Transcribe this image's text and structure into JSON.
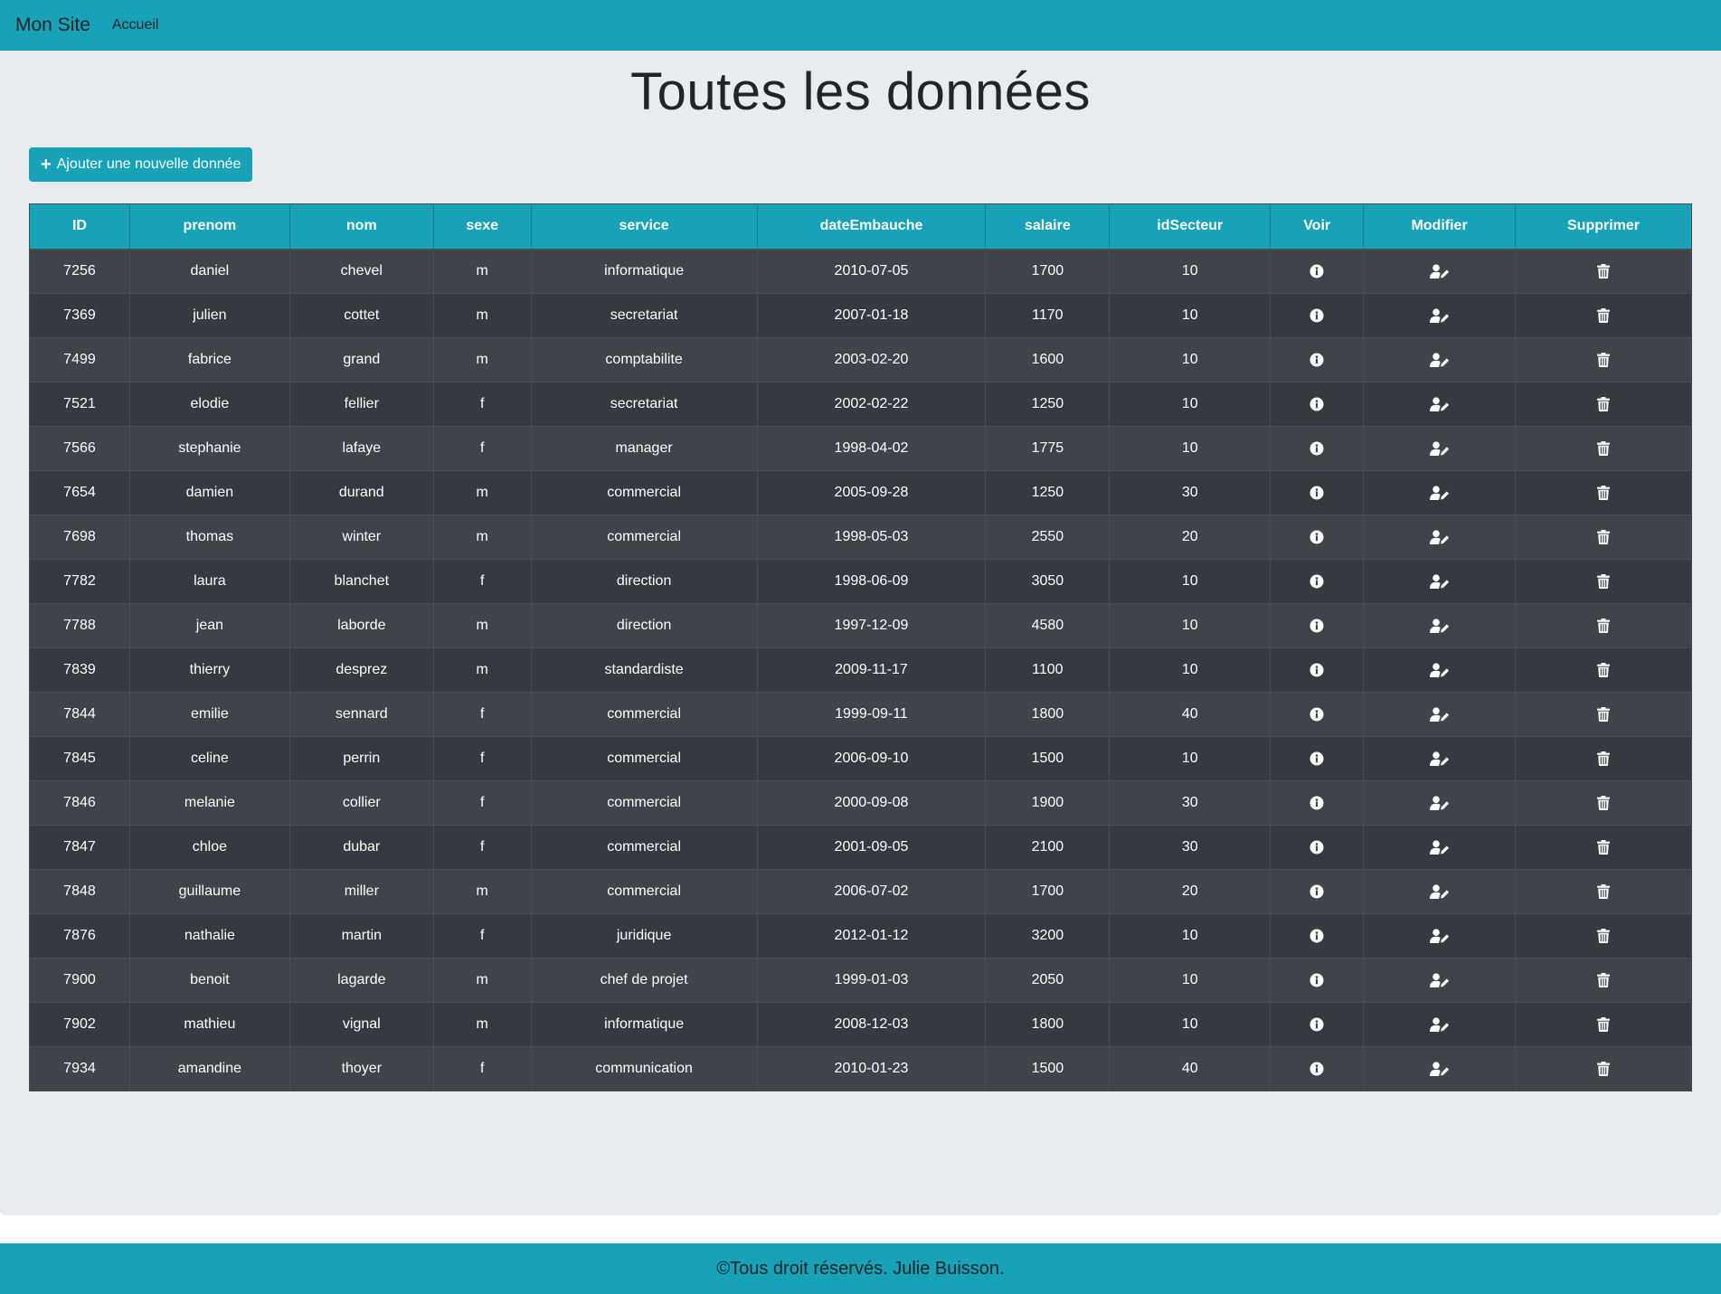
{
  "navbar": {
    "brand": "Mon Site",
    "links": [
      "Accueil"
    ]
  },
  "main": {
    "title": "Toutes les données",
    "add_button": {
      "icon": "plus-icon",
      "label": "Ajouter une nouvelle donnée"
    }
  },
  "table": {
    "headers": [
      "ID",
      "prenom",
      "nom",
      "sexe",
      "service",
      "dateEmbauche",
      "salaire",
      "idSecteur",
      "Voir",
      "Modifier",
      "Supprimer"
    ],
    "action_icons": {
      "voir": "info-circle-icon",
      "modifier": "user-edit-icon",
      "supprimer": "trash-icon"
    },
    "rows": [
      [
        "7256",
        "daniel",
        "chevel",
        "m",
        "informatique",
        "2010-07-05",
        "1700",
        "10"
      ],
      [
        "7369",
        "julien",
        "cottet",
        "m",
        "secretariat",
        "2007-01-18",
        "1170",
        "10"
      ],
      [
        "7499",
        "fabrice",
        "grand",
        "m",
        "comptabilite",
        "2003-02-20",
        "1600",
        "10"
      ],
      [
        "7521",
        "elodie",
        "fellier",
        "f",
        "secretariat",
        "2002-02-22",
        "1250",
        "10"
      ],
      [
        "7566",
        "stephanie",
        "lafaye",
        "f",
        "manager",
        "1998-04-02",
        "1775",
        "10"
      ],
      [
        "7654",
        "damien",
        "durand",
        "m",
        "commercial",
        "2005-09-28",
        "1250",
        "30"
      ],
      [
        "7698",
        "thomas",
        "winter",
        "m",
        "commercial",
        "1998-05-03",
        "2550",
        "20"
      ],
      [
        "7782",
        "laura",
        "blanchet",
        "f",
        "direction",
        "1998-06-09",
        "3050",
        "10"
      ],
      [
        "7788",
        "jean",
        "laborde",
        "m",
        "direction",
        "1997-12-09",
        "4580",
        "10"
      ],
      [
        "7839",
        "thierry",
        "desprez",
        "m",
        "standardiste",
        "2009-11-17",
        "1100",
        "10"
      ],
      [
        "7844",
        "emilie",
        "sennard",
        "f",
        "commercial",
        "1999-09-11",
        "1800",
        "40"
      ],
      [
        "7845",
        "celine",
        "perrin",
        "f",
        "commercial",
        "2006-09-10",
        "1500",
        "10"
      ],
      [
        "7846",
        "melanie",
        "collier",
        "f",
        "commercial",
        "2000-09-08",
        "1900",
        "30"
      ],
      [
        "7847",
        "chloe",
        "dubar",
        "f",
        "commercial",
        "2001-09-05",
        "2100",
        "30"
      ],
      [
        "7848",
        "guillaume",
        "miller",
        "m",
        "commercial",
        "2006-07-02",
        "1700",
        "20"
      ],
      [
        "7876",
        "nathalie",
        "martin",
        "f",
        "juridique",
        "2012-01-12",
        "3200",
        "10"
      ],
      [
        "7900",
        "benoit",
        "lagarde",
        "m",
        "chef de projet",
        "1999-01-03",
        "2050",
        "10"
      ],
      [
        "7902",
        "mathieu",
        "vignal",
        "m",
        "informatique",
        "2008-12-03",
        "1800",
        "10"
      ],
      [
        "7934",
        "amandine",
        "thoyer",
        "f",
        "communication",
        "2010-01-23",
        "1500",
        "40"
      ]
    ]
  },
  "footer": {
    "text": "©Tous droit réservés. Julie Buisson."
  },
  "colors": {
    "primary": "#17a2b8",
    "background": "#e9ecef",
    "table_row_dark": "#343a40",
    "table_row_light": "#3e444a"
  }
}
